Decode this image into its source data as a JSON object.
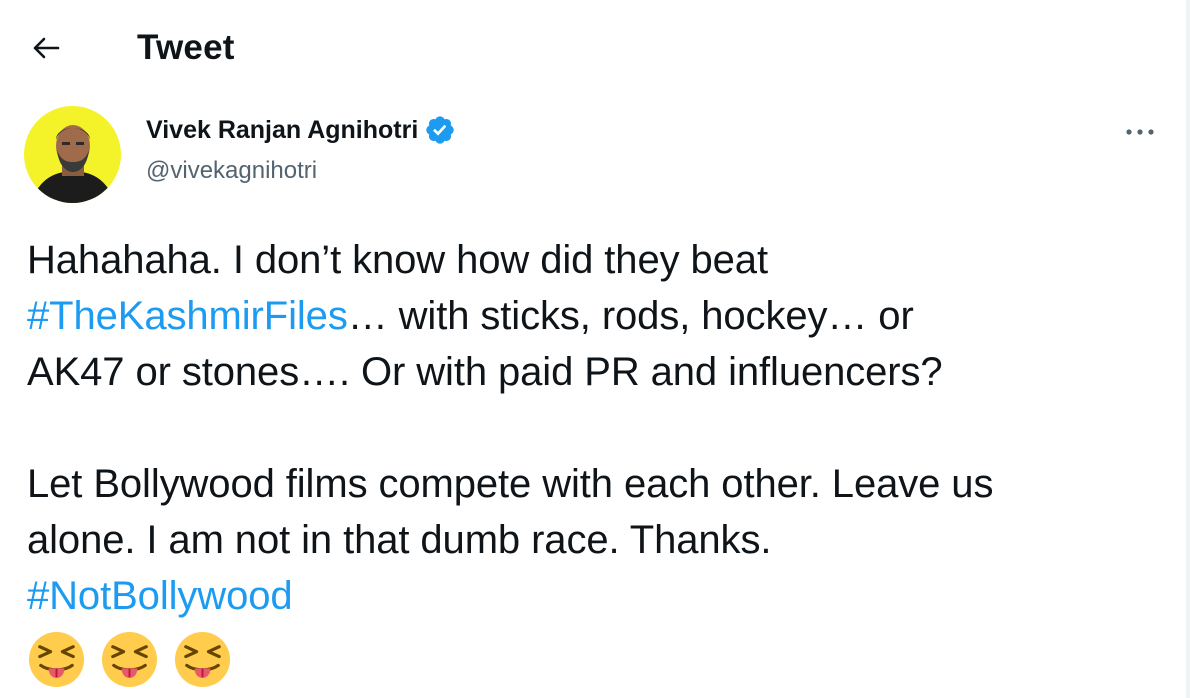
{
  "header": {
    "back_icon": "arrow-left-icon",
    "title": "Tweet"
  },
  "author": {
    "name": "Vivek Ranjan Agnihotri",
    "handle": "@vivekagnihotri",
    "verified": true,
    "verified_icon": "verified-badge-icon",
    "verified_color": "#1d9bf0"
  },
  "more_icon": "more-horizontal-icon",
  "tweet": {
    "line1": "Hahahaha. I don’t know how did they beat",
    "hashtag1": "#TheKashmirFiles",
    "line2_rest": "… with sticks, rods, hockey… or",
    "line3": "AK47 or stones…. Or with paid PR and influencers?",
    "line5": "Let Bollywood films compete with each other. Leave us",
    "line6": "alone. I am not in that dumb race. Thanks.",
    "hashtag2": "#NotBollywood",
    "emojis": [
      "squinting-face-with-tongue-icon",
      "squinting-face-with-tongue-icon",
      "squinting-face-with-tongue-icon"
    ]
  },
  "colors": {
    "link": "#1d9bf0",
    "text": "#0f1419",
    "secondary_text": "#536471",
    "avatar_bg": "#f4f32a"
  }
}
